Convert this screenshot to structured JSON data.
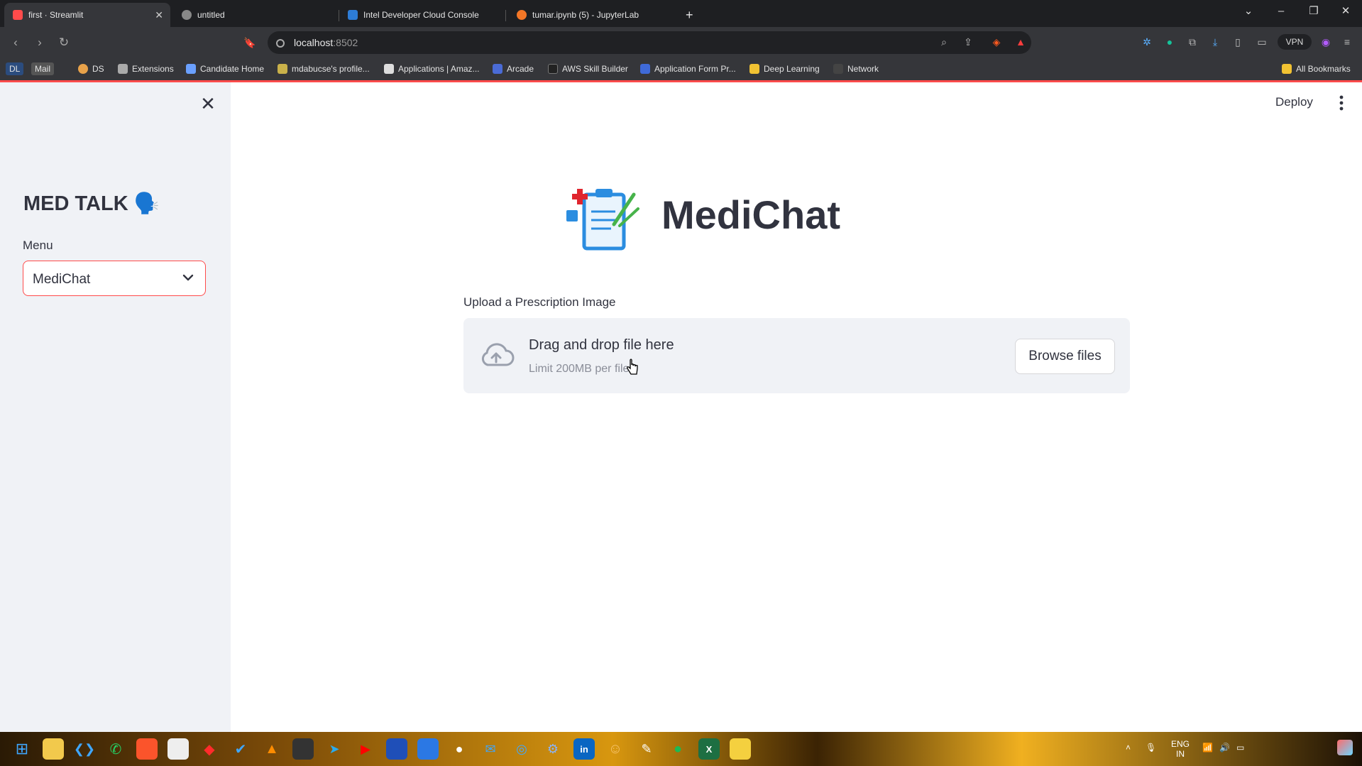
{
  "browser": {
    "tabs": [
      {
        "title": "first · Streamlit"
      },
      {
        "title": "untitled"
      },
      {
        "title": "Intel Developer Cloud Console"
      },
      {
        "title": "tumar.ipynb (5) - JupyterLab"
      }
    ],
    "url_host": "localhost",
    "url_port": ":8502",
    "vpn_label": "VPN",
    "bookmarks": [
      {
        "label": "DL"
      },
      {
        "label": "Mail"
      },
      {
        "label": "DS"
      },
      {
        "label": "Extensions"
      },
      {
        "label": "Candidate Home"
      },
      {
        "label": "mdabucse's profile..."
      },
      {
        "label": "Applications | Amaz..."
      },
      {
        "label": "Arcade"
      },
      {
        "label": "AWS Skill Builder"
      },
      {
        "label": "Application Form Pr..."
      },
      {
        "label": "Deep Learning"
      },
      {
        "label": "Network"
      },
      {
        "label": "All Bookmarks"
      }
    ]
  },
  "sidebar": {
    "title": "MED TALK 🗣️",
    "menu_label": "Menu",
    "menu_value": "MediChat"
  },
  "header": {
    "deploy_label": "Deploy"
  },
  "main": {
    "app_title": "MediChat",
    "upload_label": "Upload a Prescription Image",
    "drop_text": "Drag and drop file here",
    "limit_text": "Limit 200MB per file",
    "browse_label": "Browse files"
  },
  "taskbar": {
    "lang_line1": "ENG",
    "lang_line2": "IN"
  },
  "colors": {
    "accent": "#ff4b4b",
    "sidebar_bg": "#f0f2f6",
    "text": "#31333f"
  }
}
